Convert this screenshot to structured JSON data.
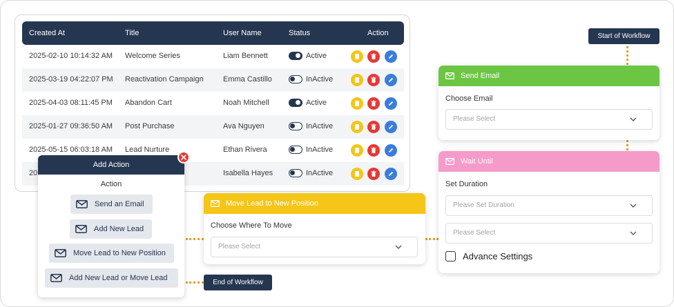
{
  "table": {
    "headers": [
      "Created At",
      "Title",
      "User Name",
      "Status",
      "Action"
    ],
    "rows": [
      {
        "created": "2025-02-10 10:14:32 AM",
        "title": "Welcome Series",
        "user": "Liam Bennett",
        "status": "Active"
      },
      {
        "created": "2025-03-19 04:22:07 PM",
        "title": "Reactivation Campaign",
        "user": "Emma Castillo",
        "status": "InActive"
      },
      {
        "created": "2025-04-03 08:11:45 PM",
        "title": "Abandon Cart",
        "user": "Noah Mitchell",
        "status": "Active"
      },
      {
        "created": "2025-01-27 09:36:50 AM",
        "title": "Post Purchase",
        "user": "Ava Nguyen",
        "status": "InActive"
      },
      {
        "created": "2025-05-15 06:03:18 AM",
        "title": "Lead Nurture",
        "user": "Ethan Rivera",
        "status": "InActive"
      },
      {
        "created": "20",
        "title": "",
        "user": "Isabella Hayes",
        "status": "InActive"
      }
    ]
  },
  "add_action": {
    "title": "Add Action",
    "subtitle": "Action",
    "options": [
      "Send an Email",
      "Add New Lead",
      "Move Lead to New Position",
      "Add New Lead or Move Lead"
    ]
  },
  "move_lead": {
    "title": "Move Lead to New Position",
    "label": "Choose Where To Move",
    "placeholder": "Please Select"
  },
  "send_email": {
    "title": "Send Email",
    "label": "Choose Email",
    "placeholder": "Please Select"
  },
  "wait_until": {
    "title": "Wait Until",
    "label": "Set Duration",
    "duration_placeholder": "Please Set Duration",
    "unit_placeholder": "Please Select",
    "advance_label": "Advance Settings"
  },
  "tags": {
    "start": "Start of Workflow",
    "end": "End of Workflow"
  },
  "colors": {
    "navy": "#253650",
    "green": "#6cc644",
    "pink": "#f59bc9",
    "yellow": "#f5c518",
    "red": "#e53935",
    "blue": "#3b7ddd",
    "connector": "#e0a030"
  },
  "icons": [
    "envelope-icon",
    "note-icon",
    "trash-icon",
    "pencil-icon",
    "close-icon",
    "chevron-down-icon"
  ]
}
